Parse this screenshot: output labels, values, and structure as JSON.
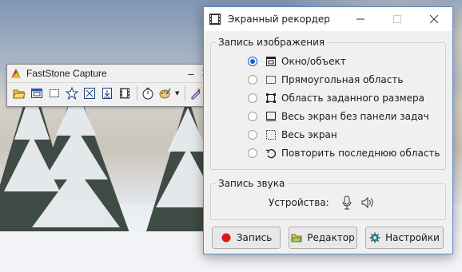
{
  "faststone": {
    "title": "FastStone Capture",
    "minimize_glyph": "–",
    "close_glyph": "✕",
    "tools": [
      "open-folder-icon",
      "capture-window-icon",
      "capture-rectangle-icon",
      "capture-freehand-icon",
      "capture-fullscreen-icon",
      "capture-scrolling-icon",
      "screen-recorder-icon",
      "delay-timer-icon",
      "output-destination-icon",
      "settings-icon"
    ]
  },
  "recorder": {
    "title": "Экранный рекордер",
    "image_group": {
      "label": "Запись изображения",
      "options": [
        {
          "label": "Окно/объект",
          "icon": "window-object-icon",
          "selected": true
        },
        {
          "label": "Прямоугольная область",
          "icon": "rectangle-area-icon",
          "selected": false
        },
        {
          "label": "Область заданного размера",
          "icon": "fixed-size-area-icon",
          "selected": false
        },
        {
          "label": "Весь экран без панели задач",
          "icon": "screen-no-taskbar-icon",
          "selected": false
        },
        {
          "label": "Весь экран",
          "icon": "full-screen-icon",
          "selected": false
        },
        {
          "label": "Повторить последнюю область",
          "icon": "repeat-area-icon",
          "selected": false
        }
      ]
    },
    "sound_group": {
      "label": "Запись звука",
      "devices_label": "Устройства:"
    },
    "buttons": {
      "record": "Запись",
      "editor": "Редактор",
      "settings": "Настройки"
    },
    "colors": {
      "accent": "#0a64d0",
      "record_dot": "#e0141e"
    }
  }
}
